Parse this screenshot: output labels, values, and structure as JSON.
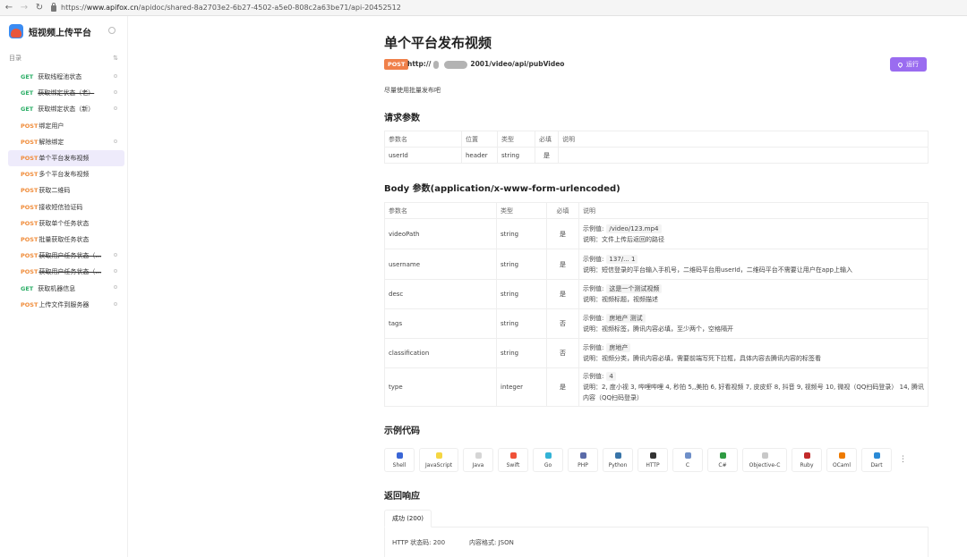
{
  "browser": {
    "url_prefix": "https://",
    "url_host": "www.apifox.cn",
    "url_path": "/apidoc/shared-8a2703e2-6b27-4502-a5e0-808c2a63be71/api-20452512"
  },
  "sidebar": {
    "project_title": "短视频上传平台",
    "toc_label": "目录",
    "items": [
      {
        "method": "GET",
        "label": "获取线程池状态",
        "strike": false,
        "active": false,
        "dot": true
      },
      {
        "method": "GET",
        "label": "获取绑定状态（老）",
        "strike": true,
        "active": false,
        "dot": true
      },
      {
        "method": "GET",
        "label": "获取绑定状态（新）",
        "strike": false,
        "active": false,
        "dot": true
      },
      {
        "method": "POST",
        "label": "绑定用户",
        "strike": false,
        "active": false,
        "dot": false
      },
      {
        "method": "POST",
        "label": "解除绑定",
        "strike": false,
        "active": false,
        "dot": true
      },
      {
        "method": "POST",
        "label": "单个平台发布视频",
        "strike": false,
        "active": true,
        "dot": false
      },
      {
        "method": "POST",
        "label": "多个平台发布视频",
        "strike": false,
        "active": false,
        "dot": false
      },
      {
        "method": "POST",
        "label": "获取二维码",
        "strike": false,
        "active": false,
        "dot": false
      },
      {
        "method": "POST",
        "label": "接收短信验证码",
        "strike": false,
        "active": false,
        "dot": false
      },
      {
        "method": "POST",
        "label": "获取单个任务状态",
        "strike": false,
        "active": false,
        "dot": false
      },
      {
        "method": "POST",
        "label": "批量获取任务状态",
        "strike": false,
        "active": false,
        "dot": false
      },
      {
        "method": "POST",
        "label": "获取用户任务状态（...",
        "strike": true,
        "active": false,
        "dot": true
      },
      {
        "method": "POST",
        "label": "获取用户任务状态（...",
        "strike": true,
        "active": false,
        "dot": true
      },
      {
        "method": "GET",
        "label": "获取机器信息",
        "strike": false,
        "active": false,
        "dot": true
      },
      {
        "method": "POST",
        "label": "上传文件到服务器",
        "strike": false,
        "active": false,
        "dot": true
      }
    ]
  },
  "api": {
    "title": "单个平台发布视频",
    "method": "POST",
    "endpoint_prefix": "http://",
    "endpoint_suffix": "2001/video/api/pubVideo",
    "run_label": "运行",
    "description": "尽量使用批量发布吧"
  },
  "request_params": {
    "title": "请求参数",
    "headers": [
      "参数名",
      "位置",
      "类型",
      "必填",
      "说明"
    ],
    "rows": [
      {
        "name": "userId",
        "location": "header",
        "type": "string",
        "required": "是",
        "desc": ""
      }
    ]
  },
  "body_params": {
    "title": "Body 参数(application/x-www-form-urlencoded)",
    "headers": [
      "参数名",
      "类型",
      "必填",
      "说明"
    ],
    "example_label": "示例值:",
    "rows": [
      {
        "name": "videoPath",
        "type": "string",
        "required": "是",
        "example": "/video/123.mp4",
        "desc": "说明：文件上传后返回的路径"
      },
      {
        "name": "username",
        "type": "string",
        "required": "是",
        "example": "137/...       1",
        "desc": "说明：短信登录的平台输入手机号，二维码平台用userId，二维码平台不需要让用户在app上输入"
      },
      {
        "name": "desc",
        "type": "string",
        "required": "是",
        "example": "这是一个测试视频",
        "desc": "说明：视频标题，视频描述"
      },
      {
        "name": "tags",
        "type": "string",
        "required": "否",
        "example": "房地产 测试",
        "desc": "说明：视频标签，腾讯内容必填，至少两个，空格隔开"
      },
      {
        "name": "classification",
        "type": "string",
        "required": "否",
        "example": "房地产",
        "desc": "说明：视频分类，腾讯内容必填，需要前端写死下拉框，具体内容去腾讯内容的标签看"
      },
      {
        "name": "type",
        "type": "integer",
        "required": "是",
        "example": "4",
        "desc": "说明：2, 度小视 3, 哔哩哔哩 4, 秒拍 5,,美拍 6, 好看视频 7, 皮皮虾 8, 抖音 9, 视频号 10, 微视（QQ扫码登录） 14, 腾讯内容（QQ扫码登录）"
      }
    ]
  },
  "code_samples": {
    "title": "示例代码",
    "languages": [
      {
        "label": "Shell",
        "icon": "shell-icon",
        "color": "#3a66d6"
      },
      {
        "label": "JavaScript",
        "icon": "javascript-icon",
        "color": "#f5d642"
      },
      {
        "label": "Java",
        "icon": "java-icon",
        "color": "#d5d5d5"
      },
      {
        "label": "Swift",
        "icon": "swift-icon",
        "color": "#f05138"
      },
      {
        "label": "Go",
        "icon": "go-icon",
        "color": "#33b3d6"
      },
      {
        "label": "PHP",
        "icon": "php-icon",
        "color": "#5a6aa8"
      },
      {
        "label": "Python",
        "icon": "python-icon",
        "color": "#3874a8"
      },
      {
        "label": "HTTP",
        "icon": "http-icon",
        "color": "#333333"
      },
      {
        "label": "C",
        "icon": "c-icon",
        "color": "#6e8fc8"
      },
      {
        "label": "C#",
        "icon": "csharp-icon",
        "color": "#2f9b42"
      },
      {
        "label": "Objective-C",
        "icon": "objective-c-icon",
        "color": "#c8c8c8"
      },
      {
        "label": "Ruby",
        "icon": "ruby-icon",
        "color": "#c22a2a"
      },
      {
        "label": "OCaml",
        "icon": "ocaml-icon",
        "color": "#ee7a00"
      },
      {
        "label": "Dart",
        "icon": "dart-icon",
        "color": "#2a8ad6"
      }
    ],
    "more": "⋮"
  },
  "response": {
    "title": "返回响应",
    "tab_label": "成功 (200)",
    "status_text": "HTTP 状态码: 200",
    "content_type_text": "内容格式: JSON"
  }
}
